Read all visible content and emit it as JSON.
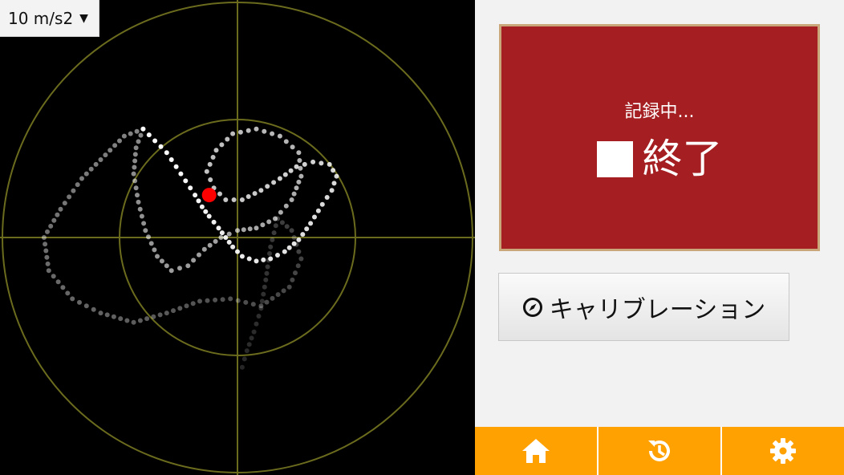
{
  "scale": {
    "label": "10 m/s2",
    "caret": "▼"
  },
  "record": {
    "status": "記録中...",
    "stop_label": "終了"
  },
  "calibration": {
    "label": "キャリブレーション",
    "icon": "compass-icon"
  },
  "nav": [
    {
      "icon": "home-icon"
    },
    {
      "icon": "history-icon"
    },
    {
      "icon": "gear-icon"
    }
  ],
  "colors": {
    "plot_background": "#000000",
    "grid": "#6b6b1e",
    "record_button": "#a51f22",
    "nav_bar": "#ffa100",
    "current_point": "#ff0000"
  },
  "trace": {
    "units": "m/s2",
    "points": [
      [
        -4.0,
        4.6
      ],
      [
        -3.5,
        4.1
      ],
      [
        -3.0,
        3.6
      ],
      [
        -2.6,
        3.0
      ],
      [
        -2.2,
        2.4
      ],
      [
        -1.8,
        1.8
      ],
      [
        -1.5,
        1.3
      ],
      [
        -1.2,
        0.9
      ],
      [
        -0.8,
        0.4
      ],
      [
        -0.5,
        0.0
      ],
      [
        -0.2,
        -0.4
      ],
      [
        0.2,
        -0.8
      ],
      [
        0.8,
        -1.0
      ],
      [
        1.4,
        -0.9
      ],
      [
        2.0,
        -0.6
      ],
      [
        2.6,
        -0.1
      ],
      [
        3.1,
        0.6
      ],
      [
        3.6,
        1.4
      ],
      [
        4.0,
        2.0
      ],
      [
        4.2,
        2.6
      ],
      [
        3.9,
        3.1
      ],
      [
        3.2,
        3.2
      ],
      [
        2.5,
        3.0
      ],
      [
        1.8,
        2.5
      ],
      [
        1.0,
        2.0
      ],
      [
        0.2,
        1.6
      ],
      [
        -0.5,
        1.6
      ],
      [
        -1.0,
        2.1
      ],
      [
        -1.3,
        2.8
      ],
      [
        -0.9,
        3.7
      ],
      [
        -0.2,
        4.4
      ],
      [
        0.8,
        4.6
      ],
      [
        1.8,
        4.3
      ],
      [
        2.6,
        3.6
      ],
      [
        2.7,
        2.6
      ],
      [
        2.3,
        1.6
      ],
      [
        1.6,
        0.8
      ],
      [
        0.8,
        0.4
      ],
      [
        0.0,
        0.3
      ],
      [
        -0.7,
        0.0
      ],
      [
        -1.4,
        -0.5
      ],
      [
        -2.1,
        -1.2
      ],
      [
        -2.8,
        -1.4
      ],
      [
        -3.4,
        -0.8
      ],
      [
        -3.9,
        0.3
      ],
      [
        -4.2,
        1.5
      ],
      [
        -4.4,
        2.7
      ],
      [
        -4.3,
        3.8
      ],
      [
        -4.0,
        4.6
      ],
      [
        -4.8,
        4.3
      ],
      [
        -5.6,
        3.5
      ],
      [
        -6.6,
        2.5
      ],
      [
        -7.5,
        1.2
      ],
      [
        -8.2,
        0.0
      ],
      [
        -8.0,
        -1.4
      ],
      [
        -7.0,
        -2.6
      ],
      [
        -5.8,
        -3.2
      ],
      [
        -4.4,
        -3.6
      ],
      [
        -3.0,
        -3.2
      ],
      [
        -1.6,
        -2.7
      ],
      [
        -0.3,
        -2.6
      ],
      [
        1.0,
        -2.9
      ],
      [
        2.2,
        -2.1
      ],
      [
        2.7,
        -0.9
      ],
      [
        2.3,
        0.3
      ],
      [
        1.7,
        0.8
      ],
      [
        1.4,
        -0.4
      ],
      [
        1.2,
        -1.8
      ],
      [
        1.0,
        -3.0
      ],
      [
        0.7,
        -4.0
      ],
      [
        0.4,
        -4.8
      ],
      [
        0.2,
        -5.5
      ]
    ],
    "current": [
      -1.2,
      1.8
    ]
  }
}
